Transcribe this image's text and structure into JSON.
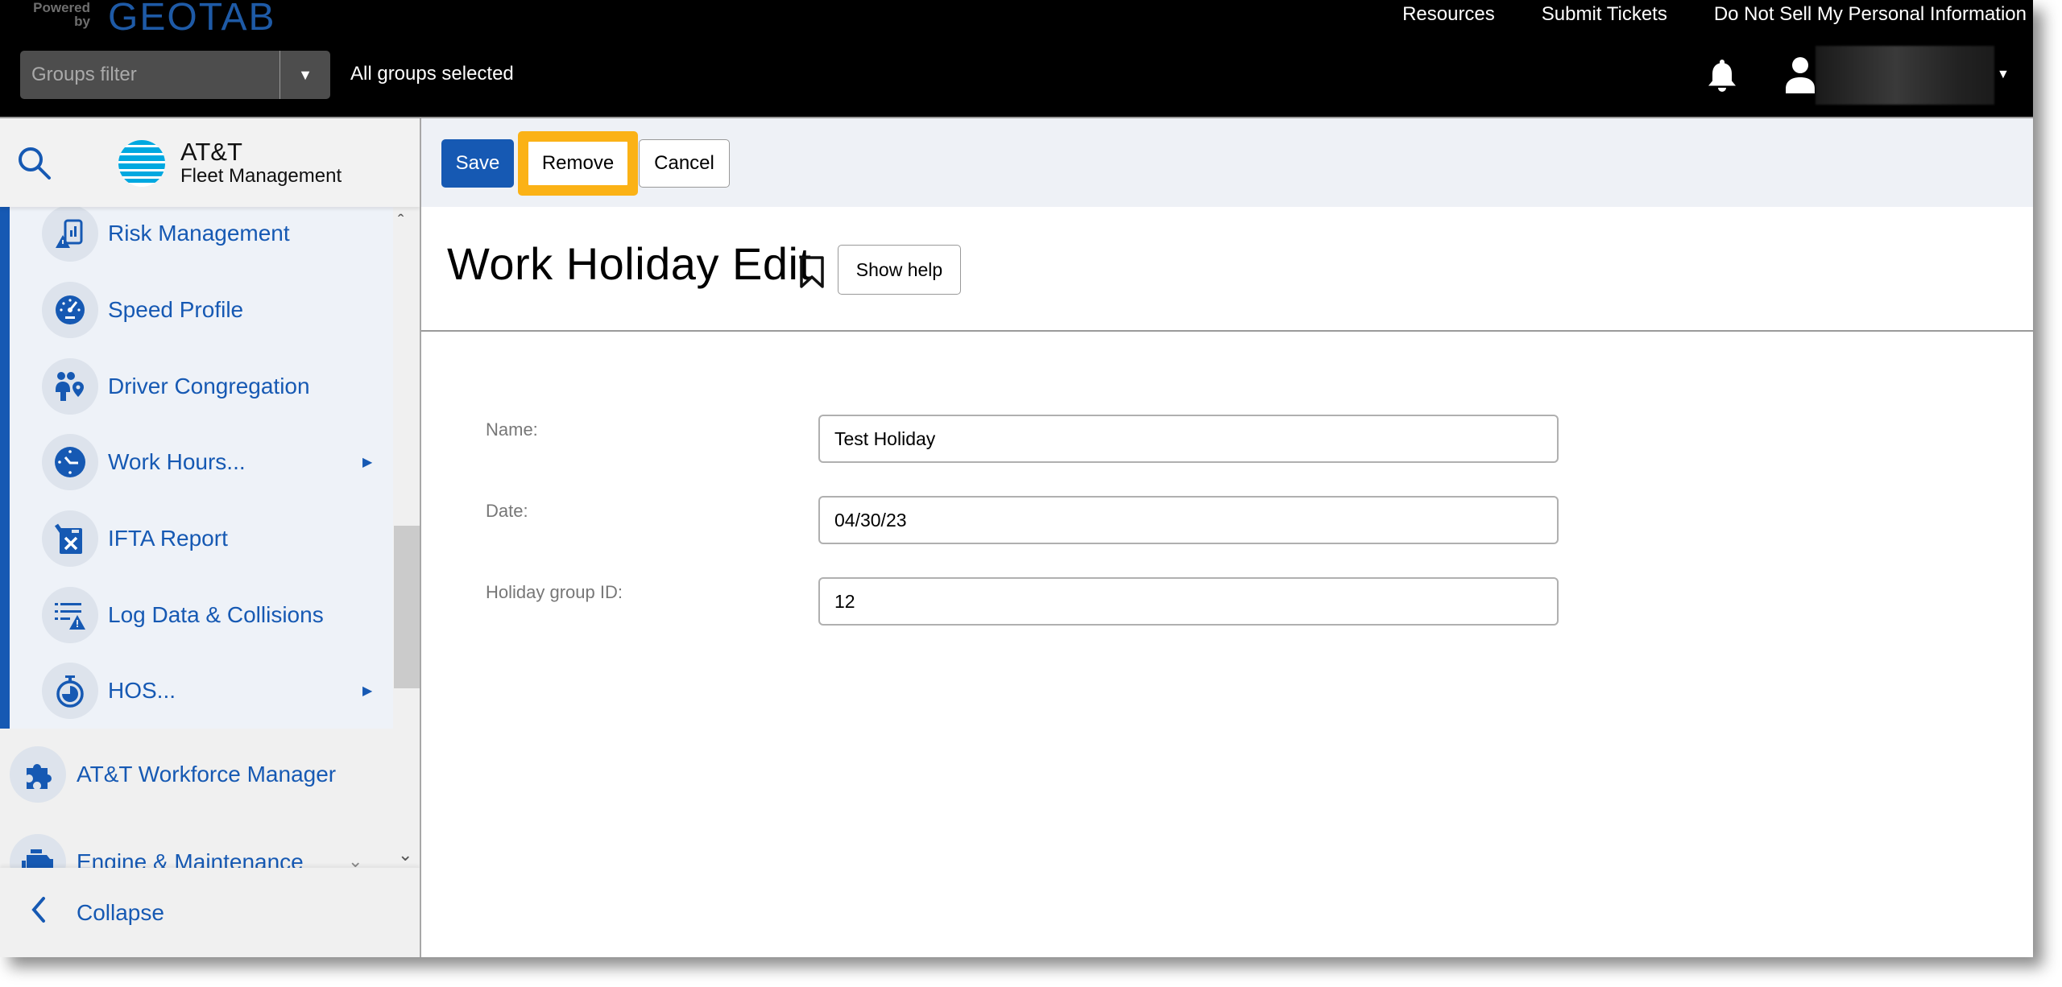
{
  "header": {
    "powered_by": "Powered by",
    "brand": "GEOTAB",
    "links": [
      "Resources",
      "Submit Tickets",
      "Do Not Sell My Personal Information"
    ],
    "groups_filter_placeholder": "Groups filter",
    "groups_status": "All groups selected",
    "icons": {
      "bell": "bell-icon",
      "user": "user-icon",
      "dropdown": "caret-down-icon"
    }
  },
  "sidebar": {
    "brand_title": "AT&T",
    "brand_subtitle": "Fleet Management",
    "nested_items": [
      {
        "label": "Risk Management",
        "icon": "risk-management-icon",
        "has_submenu": false
      },
      {
        "label": "Speed Profile",
        "icon": "speedometer-icon",
        "has_submenu": false
      },
      {
        "label": "Driver Congregation",
        "icon": "driver-congregation-icon",
        "has_submenu": false
      },
      {
        "label": "Work Hours...",
        "icon": "clock-icon",
        "has_submenu": true
      },
      {
        "label": "IFTA Report",
        "icon": "fuel-can-icon",
        "has_submenu": false
      },
      {
        "label": "Log Data & Collisions",
        "icon": "log-collision-icon",
        "has_submenu": false
      },
      {
        "label": "HOS...",
        "icon": "stopwatch-icon",
        "has_submenu": true
      }
    ],
    "top_items": [
      {
        "label": "AT&T Workforce Manager",
        "icon": "puzzle-icon"
      },
      {
        "label": "Engine & Maintenance",
        "icon": "engine-icon"
      }
    ],
    "collapse_label": "Collapse",
    "accent_color": "#1659b3"
  },
  "toolbar": {
    "save_label": "Save",
    "remove_label": "Remove",
    "cancel_label": "Cancel",
    "highlight_color": "#fbb216"
  },
  "page": {
    "title": "Work Holiday Edit",
    "show_help_label": "Show help"
  },
  "form": {
    "fields": [
      {
        "label": "Name:",
        "value": "Test Holiday"
      },
      {
        "label": "Date:",
        "value": "04/30/23"
      },
      {
        "label": "Holiday group ID:",
        "value": "12"
      }
    ]
  }
}
